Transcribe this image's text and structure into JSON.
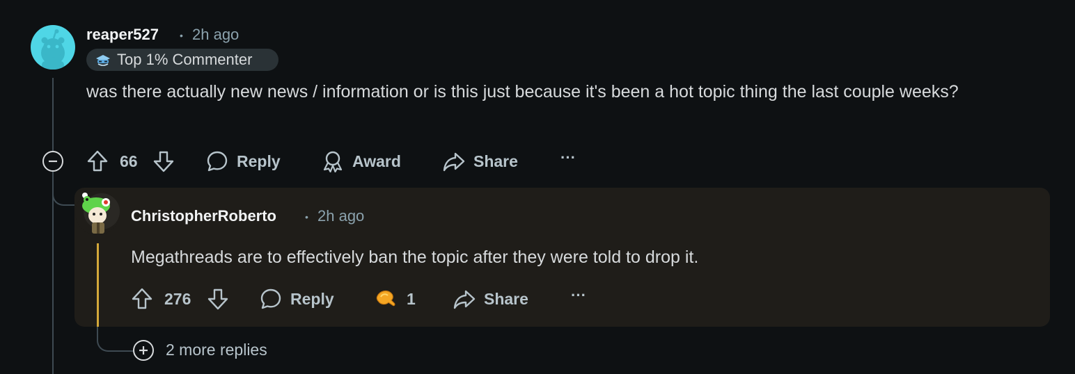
{
  "comment": {
    "username": "reaper527",
    "separator": "•",
    "time": "2h ago",
    "badge": {
      "icon": "top-commenter-icon",
      "label": "Top 1% Commenter"
    },
    "body": "was there actually new news / information or is this just because it's been a hot topic thing the last couple weeks?",
    "actions": {
      "upvotes": "66",
      "reply_label": "Reply",
      "award_label": "Award",
      "share_label": "Share",
      "more_label": "···"
    }
  },
  "reply": {
    "username": "ChristopherRoberto",
    "separator": "•",
    "time": "2h ago",
    "body": "Megathreads are to effectively ban the topic after they were told to drop it.",
    "actions": {
      "upvotes": "276",
      "reply_label": "Reply",
      "award_count": "1",
      "share_label": "Share",
      "more_label": "···"
    }
  },
  "more_replies_label": "2 more replies",
  "colors": {
    "background": "#0e1113",
    "highlight_card": "#1f1d19",
    "highlight_line": "#d4a83a",
    "avatar_teal": "#4fd6e6"
  }
}
